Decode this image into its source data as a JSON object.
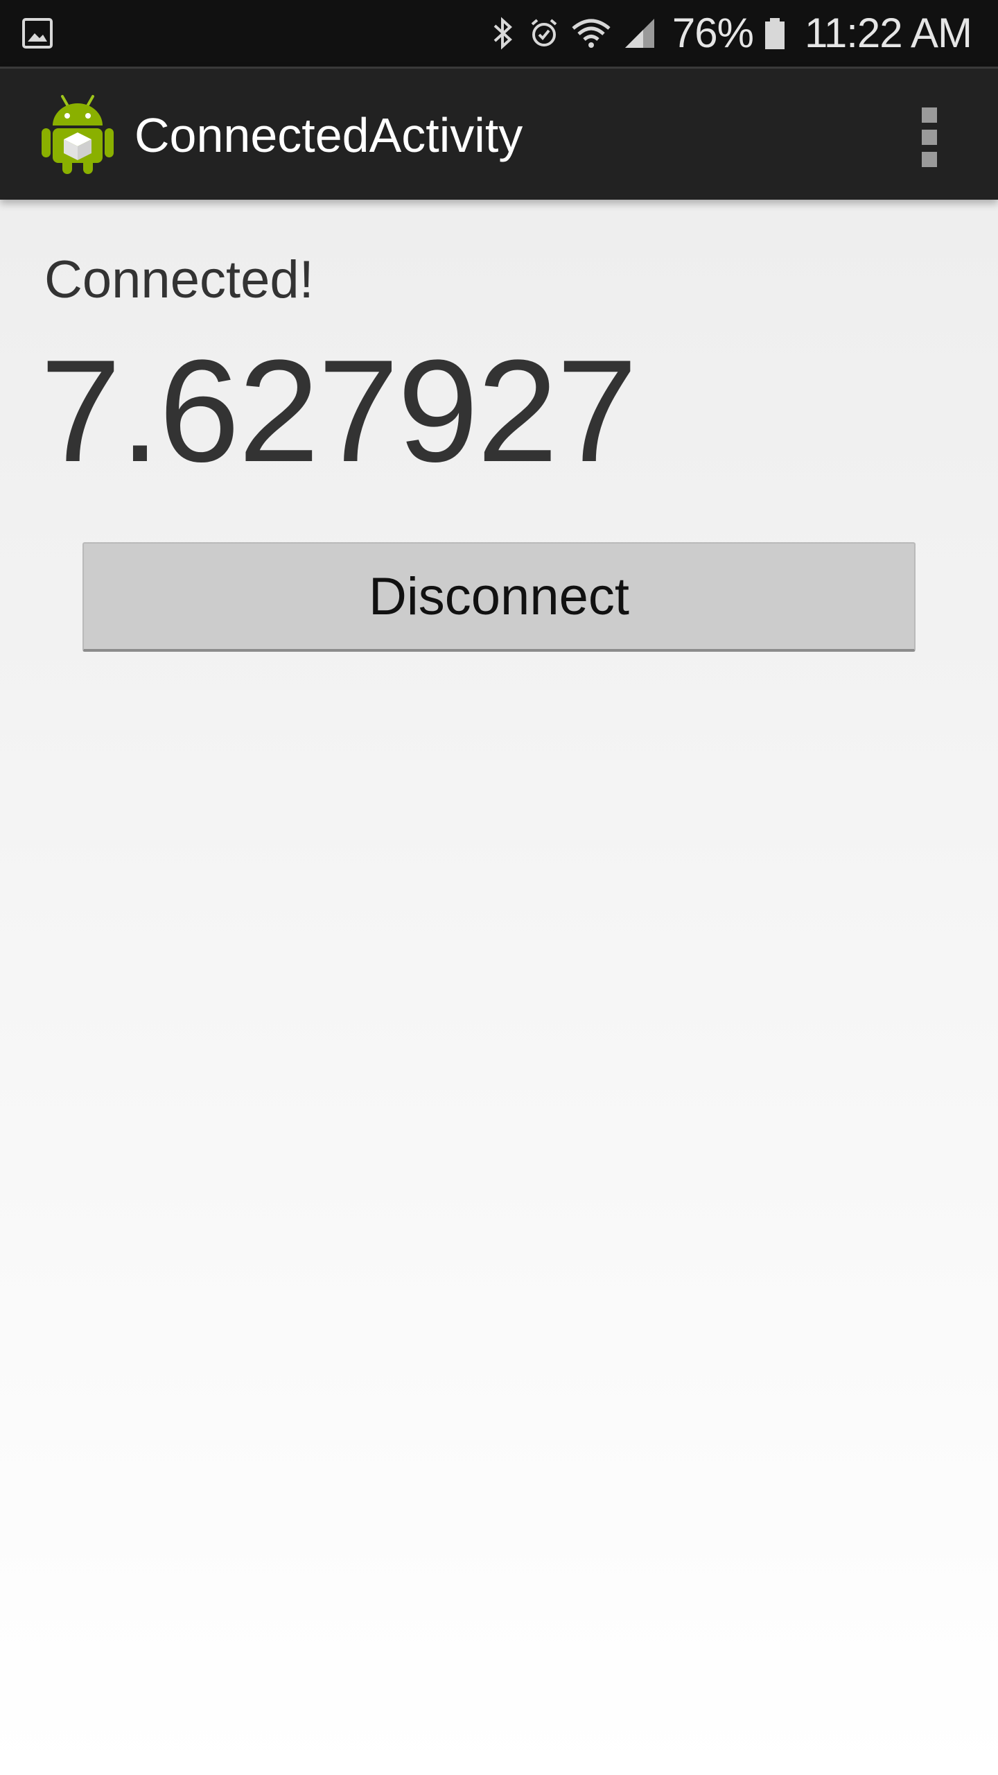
{
  "status_bar": {
    "battery_percent": "76%",
    "time": "11:22 AM",
    "icons": [
      "gallery-icon",
      "bluetooth-icon",
      "alarm-icon",
      "wifi-icon",
      "cell-signal-icon",
      "battery-icon"
    ]
  },
  "action_bar": {
    "title": "ConnectedActivity",
    "app_icon": "android-icon",
    "overflow_icon": "overflow-menu-icon"
  },
  "main": {
    "status_text": "Connected!",
    "value": "7.627927",
    "disconnect_label": "Disconnect"
  },
  "colors": {
    "status_bar_bg": "#111111",
    "action_bar_bg": "#222222",
    "android_green": "#8ab000",
    "button_bg": "#cccccc"
  }
}
